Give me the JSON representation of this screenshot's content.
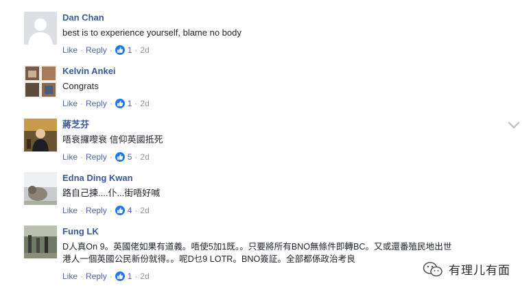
{
  "actions": {
    "like": "Like",
    "reply": "Reply",
    "sep": "·"
  },
  "comments": [
    {
      "name": "Dan Chan",
      "text": "best is to experience yourself, blame no body",
      "likes": "1",
      "time": "2d"
    },
    {
      "name": "Kelvin Ankei",
      "text": "Congrats",
      "likes": "1",
      "time": "2d"
    },
    {
      "name": "蔣芝芬",
      "text": "唔衰攞嚟衰 信仰英國抵死",
      "likes": "5",
      "time": "2d"
    },
    {
      "name": "Edna Ding Kwan",
      "text": "路自己揀....仆...街唔好喊",
      "likes": "4",
      "time": "2d"
    },
    {
      "name": "Fung LK",
      "text": "D人真On 9。英國佬如果有道義。唔使5加1既。。只要將所有BNO無條件即轉BC。又或還番殖民地出世\n港人一個英國公民新份就得。。呢D乜9 LOTR。BNO簽証。全部都係政治考良",
      "likes": "1",
      "time": "2d"
    }
  ],
  "watermark": {
    "text": "有理儿有面"
  },
  "colors": {
    "name": "#385898",
    "link": "#4b67a1",
    "meta": "#90949c",
    "like_badge": "#2078f4"
  }
}
